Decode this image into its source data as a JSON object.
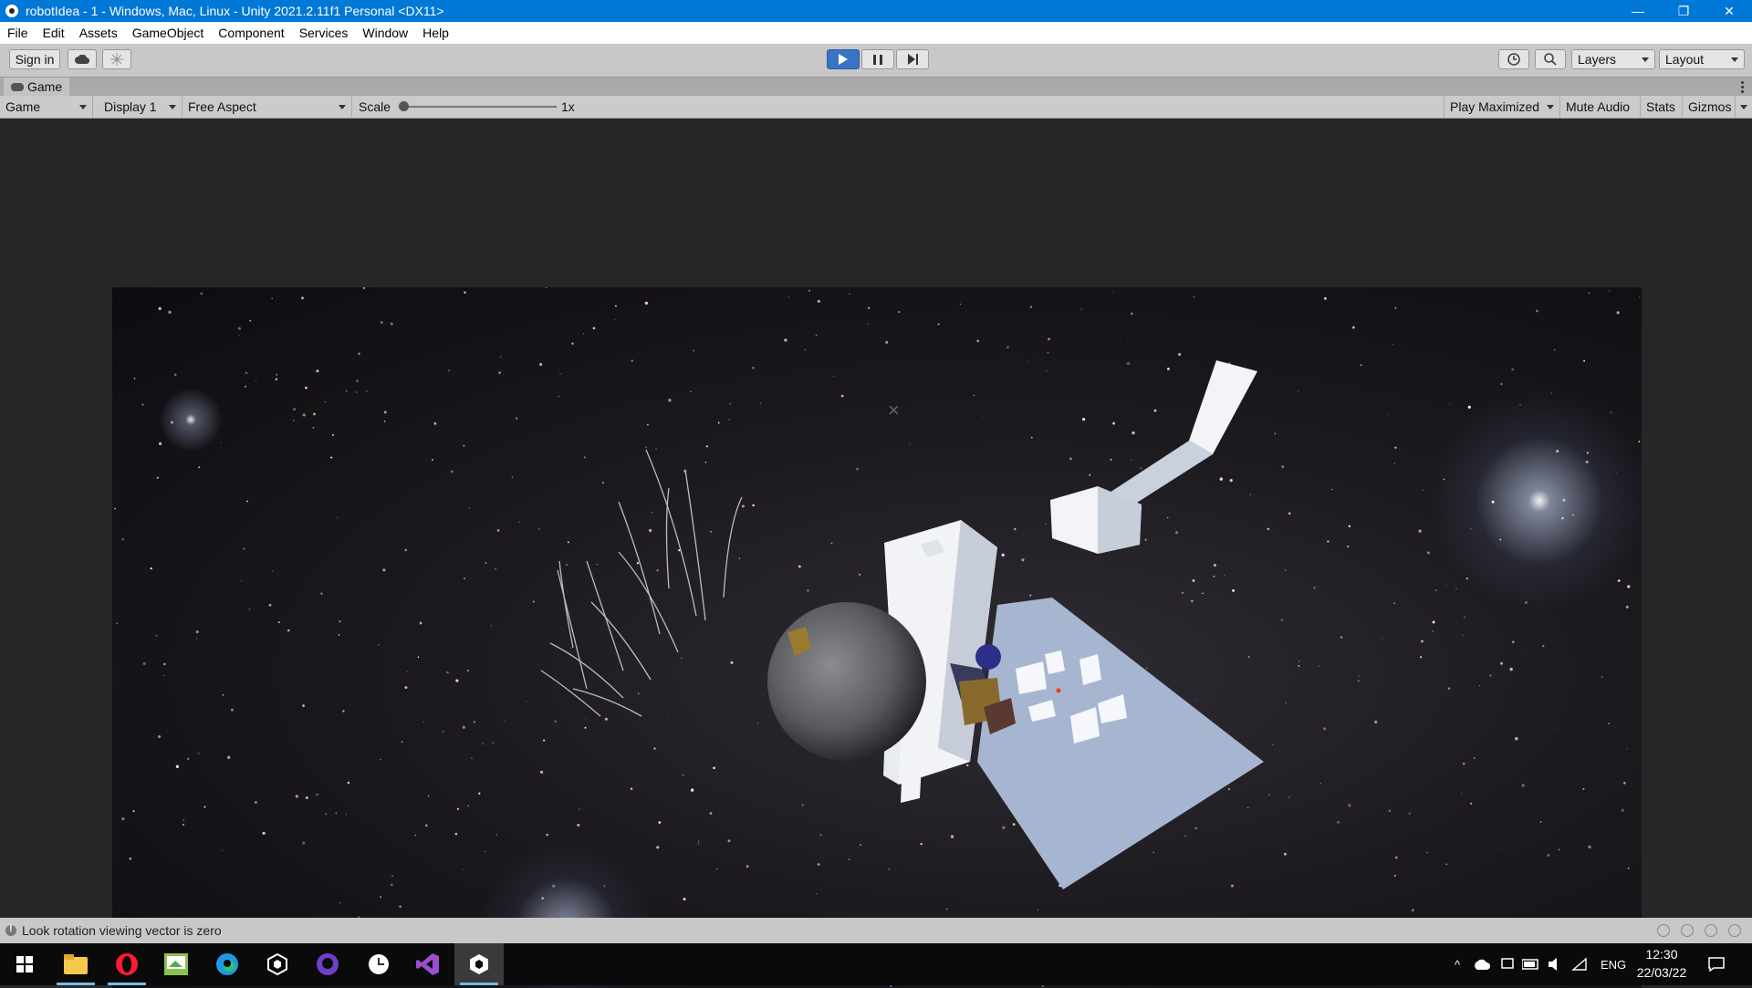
{
  "window": {
    "title": "robotIdea - 1 - Windows, Mac, Linux - Unity 2021.2.11f1 Personal <DX11>",
    "controls": {
      "minimize": "—",
      "restore": "❐",
      "close": "✕"
    }
  },
  "menubar": [
    "File",
    "Edit",
    "Assets",
    "GameObject",
    "Component",
    "Services",
    "Window",
    "Help"
  ],
  "toolbar": {
    "sign_in": "Sign in",
    "layers": "Layers",
    "layout": "Layout",
    "play_active": true
  },
  "game_tab": {
    "label": "Game"
  },
  "game_controls": {
    "view_mode": "Game",
    "display": "Display 1",
    "aspect": "Free Aspect",
    "scale_label": "Scale",
    "scale_value": "1x",
    "play_maximized": "Play Maximized",
    "mute_audio": "Mute Audio",
    "stats": "Stats",
    "gizmos": "Gizmos"
  },
  "status": {
    "message": "Look rotation viewing vector is zero"
  },
  "taskbar": {
    "tray": {
      "language": "ENG",
      "time": "12:30",
      "date": "22/03/22"
    }
  },
  "colors": {
    "title_bar": "#0078d7",
    "play_active": "#3a72c4",
    "panel": "#c8c8c8",
    "viewport": "#262626",
    "scene_primary": "#a7b6d0"
  }
}
